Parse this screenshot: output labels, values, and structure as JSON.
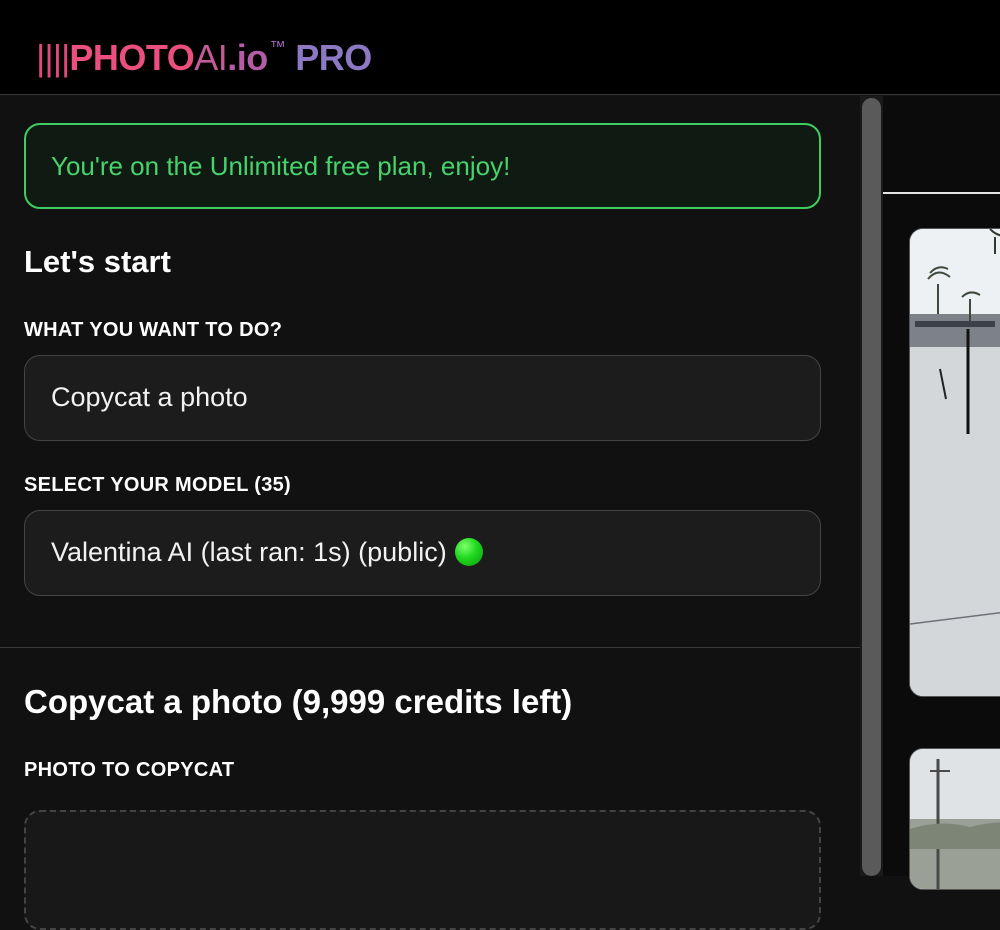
{
  "header": {
    "logo_bars": "||||",
    "logo_photo": "PHOTO",
    "logo_ai": "AI",
    "logo_io": ".io",
    "logo_tm": "™",
    "logo_pro": "PRO"
  },
  "plan_banner": {
    "text": "You're on the Unlimited free plan, enjoy!"
  },
  "start": {
    "title": "Let's start",
    "task_label": "WHAT YOU WANT TO DO?",
    "task_value": "Copycat a photo",
    "model_label": "SELECT YOUR MODEL (35)",
    "model_value": "Valentina AI (last ran: 1s) (public)"
  },
  "copycat": {
    "title": "Copycat a photo (9,999 credits left)",
    "photo_label": "PHOTO TO COPYCAT"
  },
  "colors": {
    "banner_green": "#47d26c",
    "status_dot": "#1fd81f",
    "logo_pink": "#ea4f7d",
    "logo_purple": "#8d78c4"
  }
}
